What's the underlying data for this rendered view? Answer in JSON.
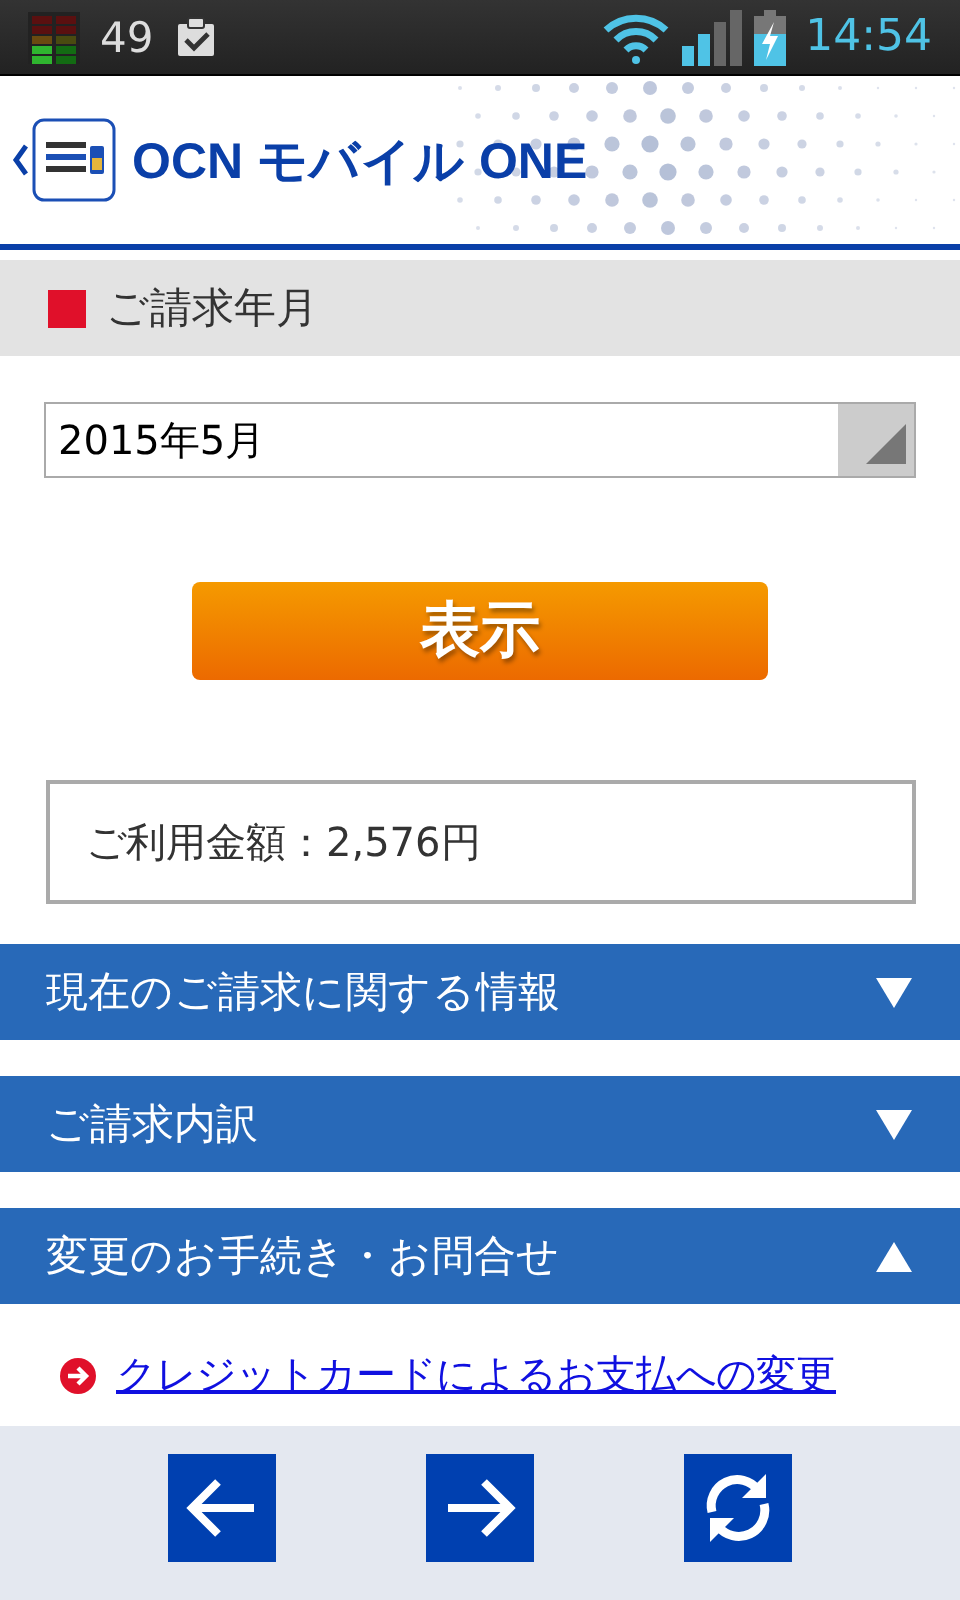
{
  "status_bar": {
    "notification_count": "49",
    "time": "14:54"
  },
  "header": {
    "title": "OCN モバイル ONE"
  },
  "billing_month": {
    "title": "ご請求年月",
    "selected_value": "2015年5月",
    "submit_button": "表示",
    "amount": "ご利用金額：2,576円"
  },
  "sections": [
    {
      "title": "現在のご請求に関する情報",
      "expanded": false
    },
    {
      "title": "ご請求内訳",
      "expanded": false
    },
    {
      "title": "変更のお手続き・お問合せ",
      "expanded": true,
      "links": [
        "クレジットカードによるお支払への変更"
      ]
    }
  ],
  "navigation": [
    {
      "kind": "back"
    },
    {
      "kind": "forward"
    },
    {
      "kind": "reload"
    }
  ]
}
